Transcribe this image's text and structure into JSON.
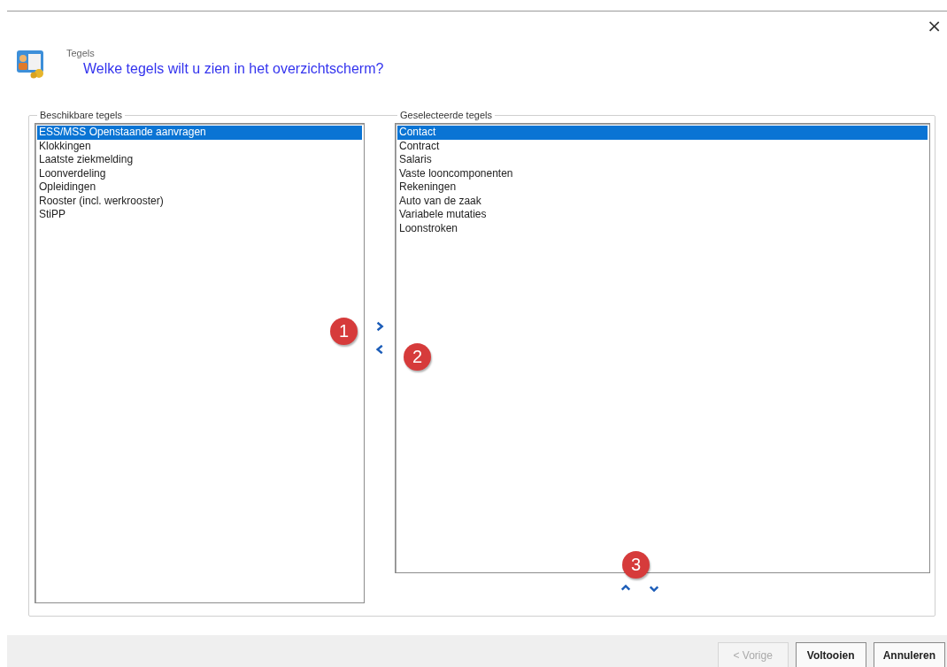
{
  "close": "×",
  "header": {
    "title": "Tegels",
    "question": "Welke tegels wilt u zien in het overzichtscherm?"
  },
  "available": {
    "label": "Beschikbare tegels",
    "items": [
      {
        "label": "ESS/MSS Openstaande aanvragen",
        "selected": true
      },
      {
        "label": "Klokkingen",
        "selected": false
      },
      {
        "label": "Laatste ziekmelding",
        "selected": false
      },
      {
        "label": "Loonverdeling",
        "selected": false
      },
      {
        "label": "Opleidingen",
        "selected": false
      },
      {
        "label": "Rooster (incl. werkrooster)",
        "selected": false
      },
      {
        "label": "StiPP",
        "selected": false
      }
    ]
  },
  "selected_tiles": {
    "label": "Geselecteerde tegels",
    "items": [
      {
        "label": "Contact",
        "selected": true
      },
      {
        "label": "Contract",
        "selected": false
      },
      {
        "label": "Salaris",
        "selected": false
      },
      {
        "label": "Vaste looncomponenten",
        "selected": false
      },
      {
        "label": "Rekeningen",
        "selected": false
      },
      {
        "label": "Auto van de zaak",
        "selected": false
      },
      {
        "label": "Variabele mutaties",
        "selected": false
      },
      {
        "label": "Loonstroken",
        "selected": false
      }
    ]
  },
  "callouts": [
    "1",
    "2",
    "3"
  ],
  "buttons": [
    {
      "label": "< Vorige",
      "disabled": true
    },
    {
      "label": "Voltooien",
      "disabled": false
    },
    {
      "label": "Annuleren",
      "disabled": false
    }
  ]
}
